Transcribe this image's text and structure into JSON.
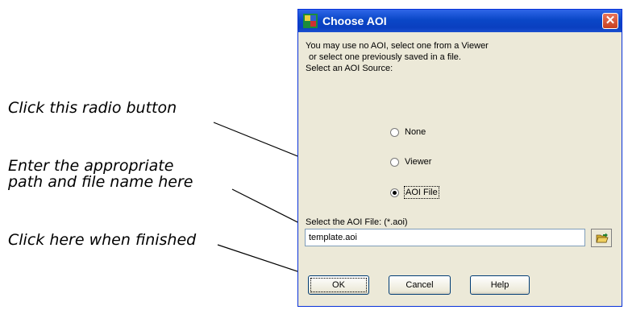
{
  "callouts": {
    "radio": "Click this radio button",
    "path_line1": "Enter the appropriate",
    "path_line2": "path and file name here",
    "finish": "Click here when finished"
  },
  "dialog": {
    "title": "Choose AOI",
    "instructions": [
      "You may use no AOI, select one from a Viewer",
      "or select one previously saved in a file.",
      "Select an AOI Source:"
    ],
    "radio_options": [
      {
        "label": "None",
        "selected": false
      },
      {
        "label": "Viewer",
        "selected": false
      },
      {
        "label": "AOI File",
        "selected": true
      }
    ],
    "file_label": "Select the AOI File: (*.aoi)",
    "file_value": "template.aoi",
    "buttons": {
      "ok": "OK",
      "cancel": "Cancel",
      "help": "Help"
    }
  },
  "icons": {
    "app": "aoi-app-icon",
    "close": "close-icon",
    "browse": "folder-open-icon"
  },
  "colors": {
    "titlebar": "#0a47c7",
    "dialog_bg": "#ece9d8",
    "close": "#c9401f"
  }
}
